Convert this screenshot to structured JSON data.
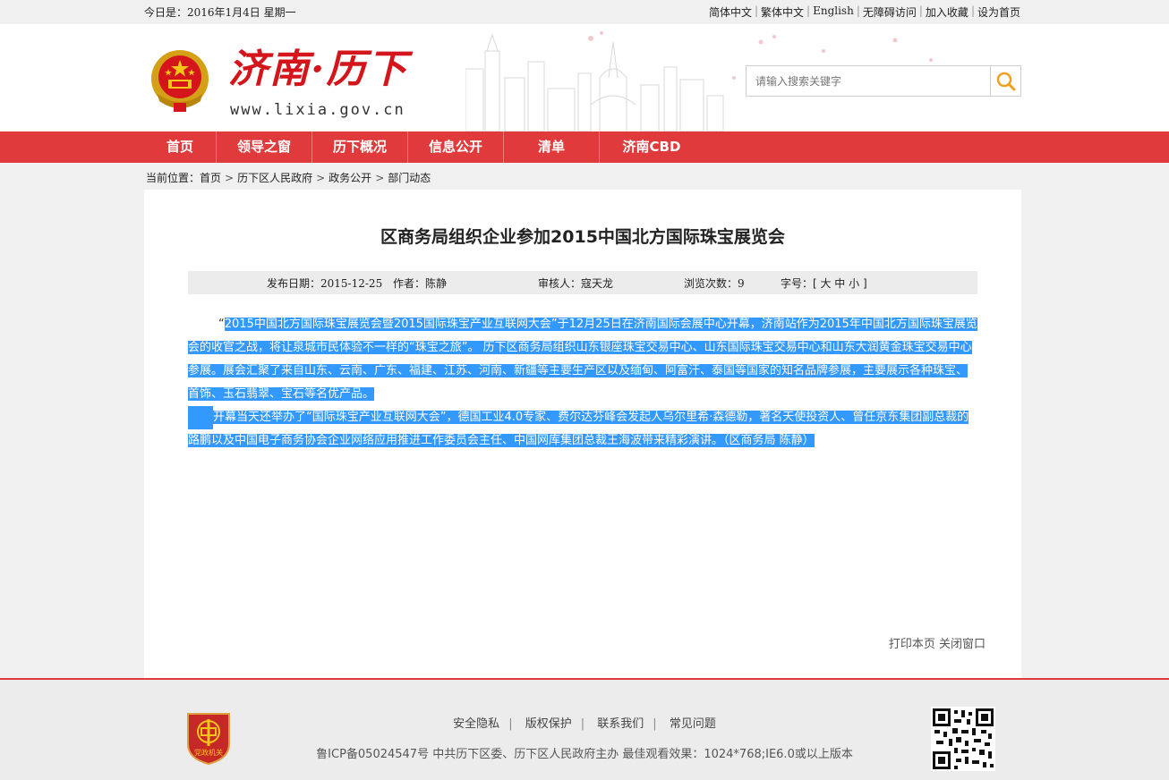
{
  "topbar": {
    "date": "今日是：2016年1月4日 星期一",
    "links": [
      "简体中文",
      "繁体中文",
      "English",
      "无障碍访问",
      "加入收藏",
      "设为首页"
    ]
  },
  "header": {
    "logo_title": "济南·历下",
    "logo_url": "www.lixia.gov.cn",
    "search_placeholder": "请输入搜索关键字"
  },
  "nav": {
    "items": [
      "首页",
      "领导之窗",
      "历下概况",
      "信息公开",
      "清单",
      "济南CBD"
    ]
  },
  "breadcrumb": {
    "label": "当前位置：",
    "items": [
      "首页",
      "历下区人民政府",
      "政务公开",
      "部门动态"
    ]
  },
  "article": {
    "title": "区商务局组织企业参加2015中国北方国际珠宝展览会",
    "meta": {
      "publish_label": "发布日期：",
      "publish_date": "2015-12-25",
      "author": "作者：陈静",
      "reviewer": "审核人：寇天龙",
      "views_label": "浏览次数：",
      "views": "9",
      "font_size": "字号：[ 大 中 小 ]"
    },
    "para1_lead": "“",
    "para1": "2015中国北方国际珠宝展览会暨2015国际珠宝产业互联网大会”于12月25日在济南国际会展中心开幕，济南站作为2015年中国北方国际珠宝展览会的收官之战，将让泉城市民体验不一样的“珠宝之旅”。 历下区商务局组织山东银座珠宝交易中心、山东国际珠宝交易中心和山东大润黄金珠宝交易中心参展。展会汇聚了来自山东、云南、广东、福建、江苏、河南、新疆等主要生产区以及缅甸、阿富汗、泰国等国家的知名品牌参展，主要展示各种珠宝、首饰、玉石翡翠、宝石等名优产品。",
    "para2": "开幕当天还举办了“国际珠宝产业互联网大会”，德国工业4.0专家、费尔达芬峰会发起人乌尔里希·森德勒，著名天使投资人、曾任京东集团副总裁的路鹏以及中国电子商务协会企业网络应用推进工作委员会主任、中国网库集团总裁王海波带来精彩演讲。（区商务局 陈静）",
    "print": "打印本页",
    "close": "关闭窗口"
  },
  "footer": {
    "links": [
      "安全隐私",
      "版权保护",
      "联系我们",
      "常见问题"
    ],
    "copyright": "鲁ICP备05024547号 中共历下区委、历下区人民政府主办 最佳观看效果：1024*768;IE6.0或以上版本",
    "badge_text": "党政机关"
  },
  "colors": {
    "brand_red": "#e13a3c",
    "selection_blue": "#3399ff"
  }
}
